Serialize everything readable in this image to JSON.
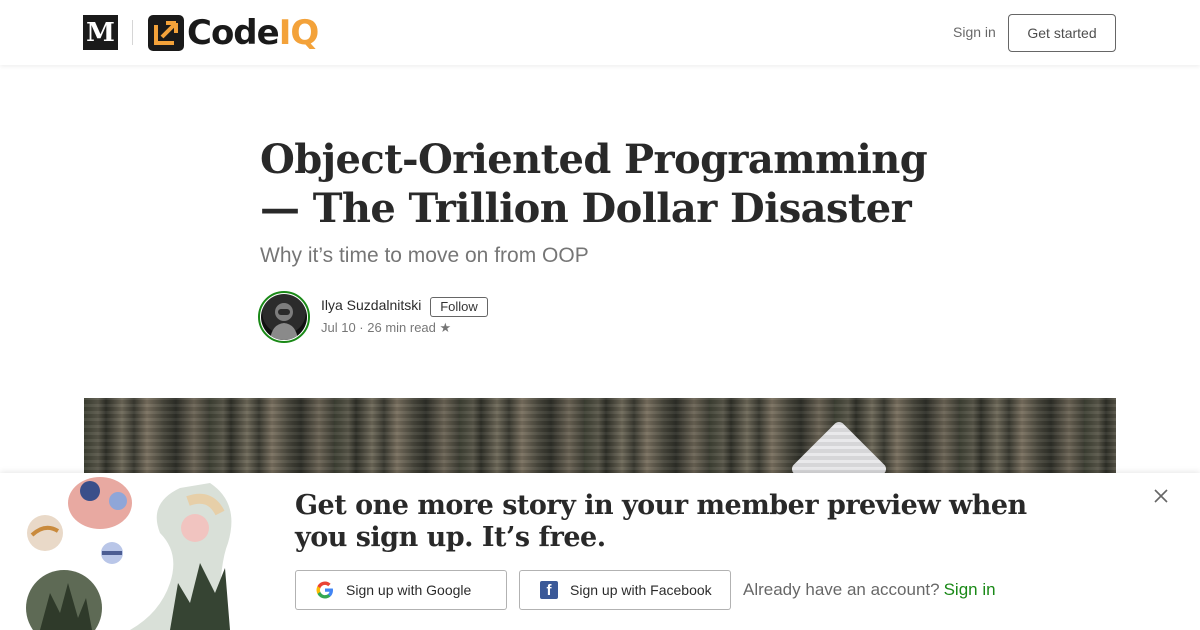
{
  "header": {
    "m_logo": "M",
    "brand_code": "Code",
    "brand_iq": "IQ",
    "sign_in": "Sign in",
    "get_started": "Get started"
  },
  "article": {
    "title": "Object-Oriented Programming — The Trillion Dollar Disaster",
    "subtitle": "Why it’s time to move on from OOP",
    "author": "Ilya Suzdalnitski",
    "follow": "Follow",
    "meta": "Jul 10 · 26 min read",
    "star": "★"
  },
  "banner": {
    "headline": "Get one more story in your member preview when you sign up. It’s free.",
    "google_button": "Sign up with Google",
    "facebook_button": "Sign up with Facebook",
    "already_text": "Already have an account?",
    "sign_in_link": "Sign in"
  },
  "colors": {
    "accent_green": "#1a8917",
    "brand_orange": "#f3a23a",
    "facebook_blue": "#3b5998"
  },
  "icons": [
    "m-logo-icon",
    "codeiq-logo-icon",
    "google-icon",
    "facebook-icon",
    "close-icon",
    "star-icon"
  ]
}
